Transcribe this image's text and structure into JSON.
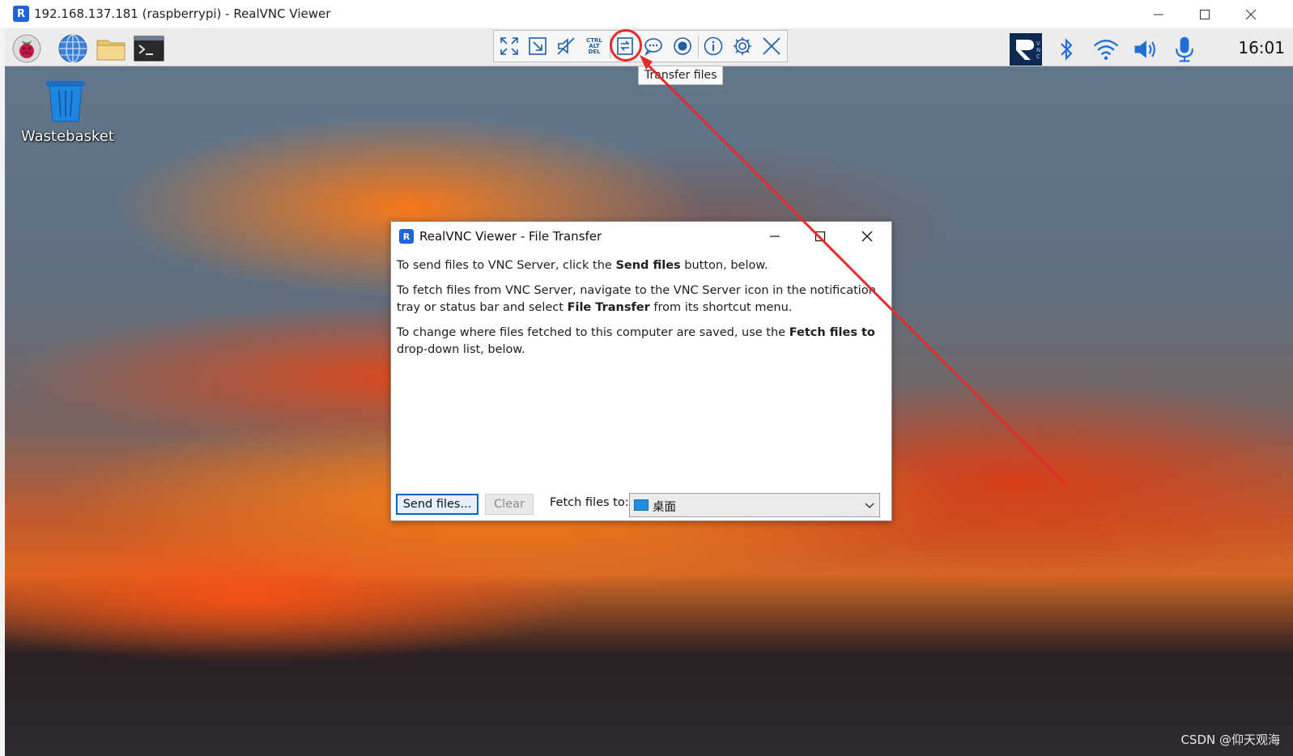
{
  "window": {
    "title": "192.168.137.181 (raspberrypi) - RealVNC Viewer",
    "logo_letter": "R"
  },
  "remote_panel": {
    "launcher_icons": [
      "raspberry-menu-icon",
      "globe-icon",
      "folder-icon",
      "terminal-icon"
    ],
    "vnc_toolbar": {
      "buttons": [
        {
          "name": "fullscreen-icon"
        },
        {
          "name": "scale-icon"
        },
        {
          "name": "mute-audio-icon"
        },
        {
          "name": "ctrl-alt-del-icon",
          "label_lines": [
            "CTRL",
            "ALT",
            "DEL"
          ]
        },
        {
          "name": "transfer-files-icon"
        },
        {
          "name": "chat-icon"
        },
        {
          "name": "record-icon"
        },
        {
          "name": "info-icon"
        },
        {
          "name": "settings-icon"
        },
        {
          "name": "close-icon"
        }
      ],
      "tooltip": "Transfer files"
    },
    "tray": {
      "icons": [
        "vnc-server-icon",
        "bluetooth-icon",
        "wifi-icon",
        "volume-icon",
        "microphone-icon"
      ],
      "clock": "16:01"
    }
  },
  "desktop": {
    "wastebasket_label": "Wastebasket"
  },
  "dialog": {
    "title": "RealVNC Viewer - File Transfer",
    "logo_letter": "R",
    "p1_pre": "To send files to VNC Server, click the ",
    "p1_bold": "Send files",
    "p1_post": " button, below.",
    "p2_pre": "To fetch files from VNC Server, navigate to the VNC Server icon in the notification tray or status bar and select ",
    "p2_bold": "File Transfer",
    "p2_post": " from its shortcut menu.",
    "p3_pre": "To change where files fetched to this computer are saved, use the ",
    "p3_bold": "Fetch files to",
    "p3_post": " drop-down list, below.",
    "send_button": "Send files...",
    "clear_button": "Clear",
    "fetch_label": "Fetch files to:",
    "fetch_value": "桌面"
  },
  "watermark": "CSDN @仰天观海",
  "colors": {
    "annotation": "#e42b2b",
    "accent": "#1c64d8",
    "icon_blue": "#1f5fa8"
  }
}
